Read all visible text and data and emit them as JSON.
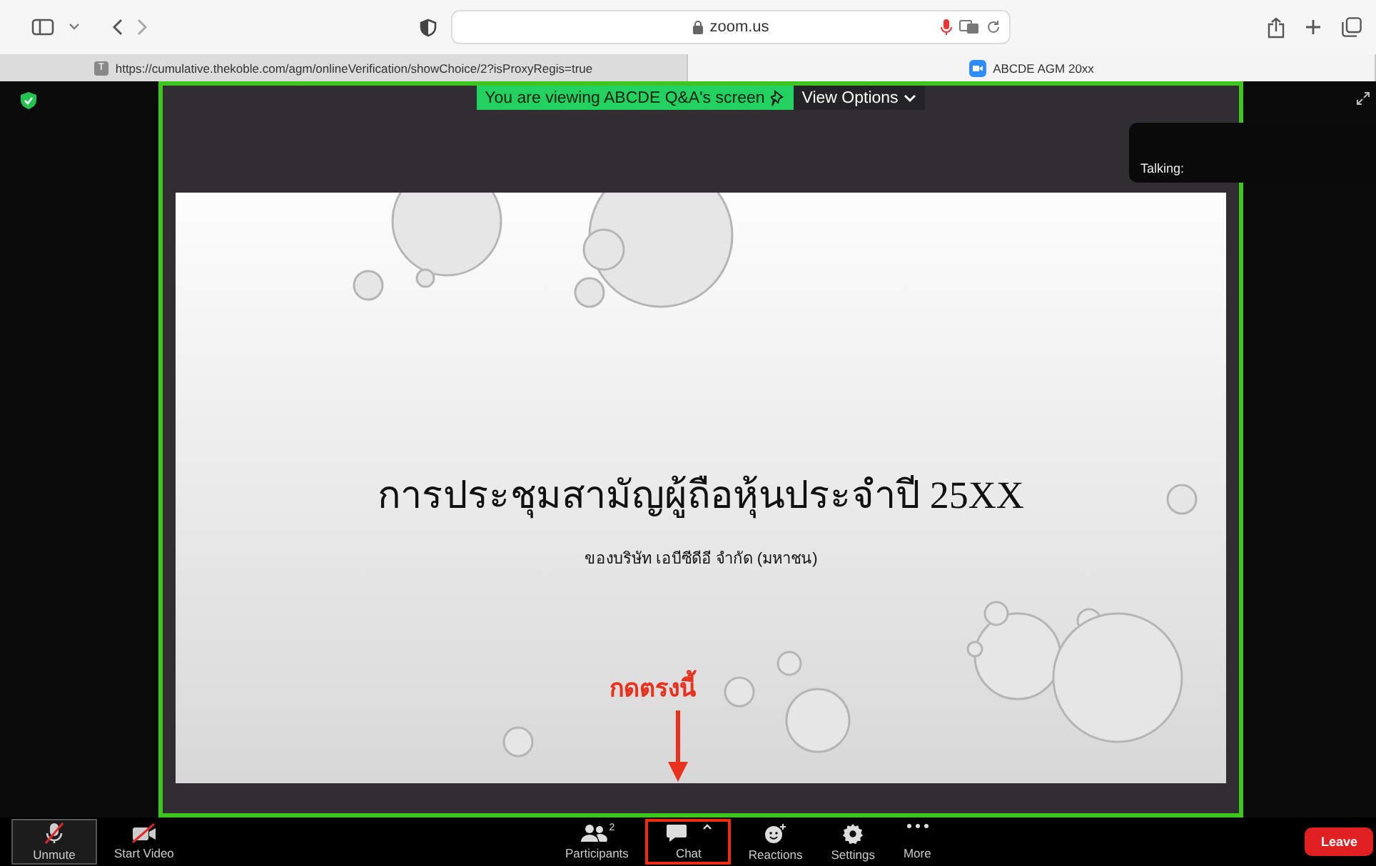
{
  "browser": {
    "address": "zoom.us",
    "tabs": [
      {
        "label": "https://cumulative.thekoble.com/agm/onlineVerification/showChoice/2?isProxyRegis=true",
        "favicon": "T",
        "selected": false
      },
      {
        "label": "ABCDE AGM 20xx",
        "selected": true
      }
    ]
  },
  "share_banner": {
    "text": "You are viewing ABCDE Q&A's screen",
    "view_options": "View Options"
  },
  "talking": "Talking:",
  "slide": {
    "title": "การประชุมสามัญผู้ถือหุ้นประจำปี 25XX",
    "subtitle": "ของบริษัท เอบีซีดีอี จำกัด (มหาชน)"
  },
  "annotation": "กดตรงนี้",
  "toolbar": {
    "left": [
      {
        "label": "Unmute",
        "kind": "mic"
      },
      {
        "label": "Start Video",
        "kind": "video"
      }
    ],
    "center": [
      {
        "label": "Participants",
        "kind": "participants",
        "badge": "2",
        "highlighted": false
      },
      {
        "label": "Chat",
        "kind": "chat",
        "highlighted": true
      },
      {
        "label": "Reactions",
        "kind": "reactions",
        "highlighted": false
      },
      {
        "label": "Settings",
        "kind": "settings",
        "highlighted": false
      },
      {
        "label": "More",
        "kind": "more",
        "highlighted": false
      }
    ],
    "leave": "Leave"
  }
}
